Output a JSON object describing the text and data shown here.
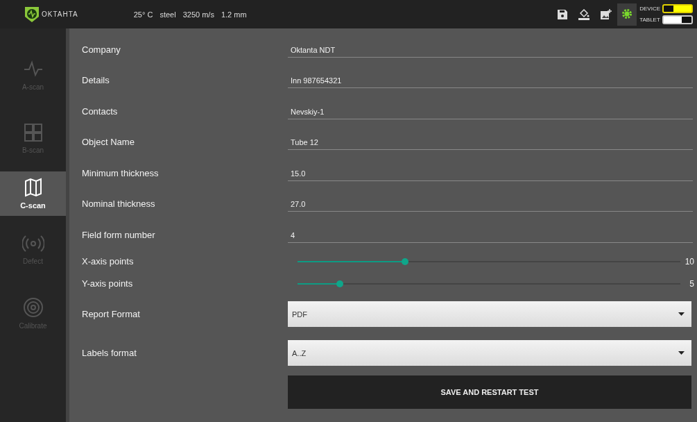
{
  "header": {
    "logo_text": "OKTAHTA",
    "status": [
      "25° C",
      "steel",
      "3250 m/s",
      "1.2 mm"
    ],
    "toggles": [
      {
        "label": "DEVICE",
        "on": true
      },
      {
        "label": "TABLET",
        "on": false
      }
    ]
  },
  "sidebar": {
    "items": [
      {
        "label": "A-scan",
        "selected": false
      },
      {
        "label": "B-scan",
        "selected": false
      },
      {
        "label": "C-scan",
        "selected": true
      },
      {
        "label": "Defect",
        "selected": false
      },
      {
        "label": "Calibrate",
        "selected": false
      }
    ]
  },
  "form": {
    "fields": [
      {
        "kind": "text",
        "label": "Company",
        "value": "Oktanta NDT"
      },
      {
        "kind": "text",
        "label": "Details",
        "value": "Inn 987654321"
      },
      {
        "kind": "text",
        "label": "Contacts",
        "value": "Nevskiy-1"
      },
      {
        "kind": "text",
        "label": "Object Name",
        "value": "Tube 12"
      },
      {
        "kind": "text",
        "label": "Minimum thickness",
        "value": "15.0"
      },
      {
        "kind": "text",
        "label": "Nominal thickness",
        "value": "27.0"
      },
      {
        "kind": "text",
        "label": "Field form number",
        "value": "4"
      },
      {
        "kind": "slider",
        "label": "X-axis points",
        "level": 0.28,
        "reading": "10"
      },
      {
        "kind": "slider",
        "label": "Y-axis points",
        "level": 0.11,
        "reading": "5"
      },
      {
        "kind": "select",
        "label": "Report Format",
        "value": "PDF"
      },
      {
        "kind": "select",
        "label": "Labels format",
        "value": "A..Z"
      }
    ],
    "button": "SAVE AND RESTART TEST"
  }
}
